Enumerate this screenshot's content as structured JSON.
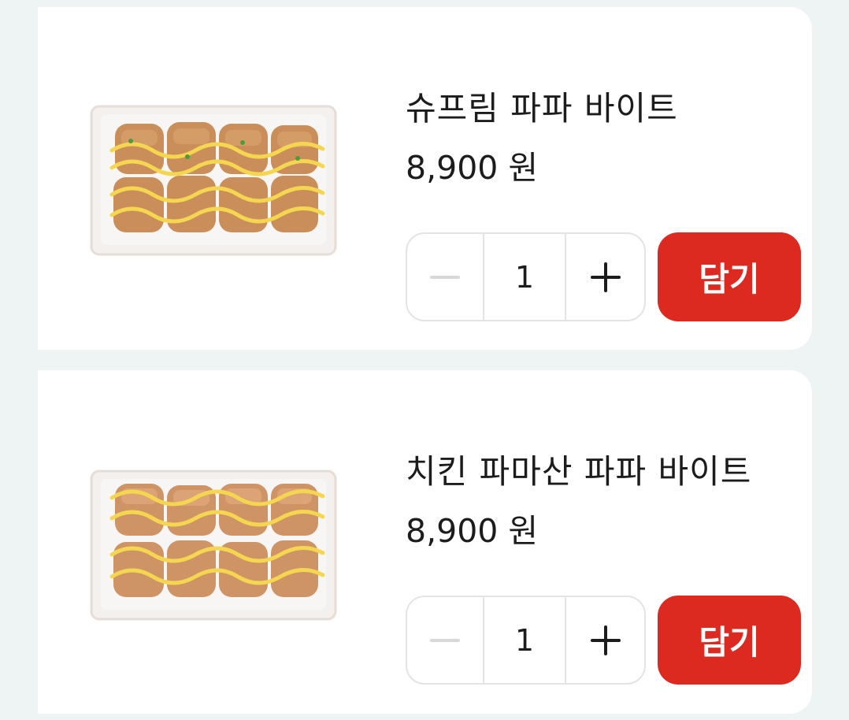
{
  "products": [
    {
      "name": "슈프림 파파 바이트",
      "price": "8,900 원",
      "quantity": "1",
      "add_label": "담기",
      "image": "pizza-bites-dish"
    },
    {
      "name": "치킨 파마산 파파 바이트",
      "price": "8,900 원",
      "quantity": "1",
      "add_label": "담기",
      "image": "pizza-bites-dish"
    }
  ],
  "colors": {
    "accent": "#dd2a20",
    "background": "#eef3f4",
    "card": "#ffffff",
    "text": "#1c1c1c",
    "border": "#e2e4e6",
    "disabled": "#d6d8da"
  },
  "icons": {
    "decrement": "minus-icon",
    "increment": "plus-icon"
  }
}
